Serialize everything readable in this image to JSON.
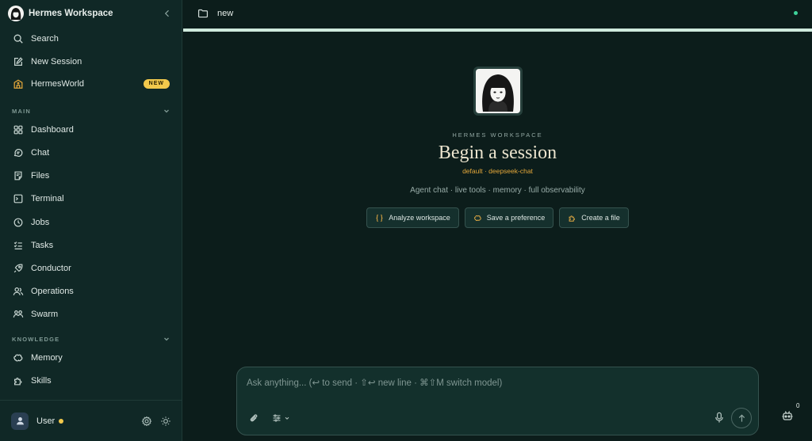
{
  "sidebar": {
    "title": "Hermes Workspace",
    "top_items": [
      {
        "label": "Search",
        "icon": "search-icon"
      },
      {
        "label": "New Session",
        "icon": "compose-icon"
      },
      {
        "label": "HermesWorld",
        "icon": "world-icon",
        "badge": "NEW"
      }
    ],
    "sections": [
      {
        "label": "MAIN",
        "items": [
          {
            "label": "Dashboard",
            "icon": "grid-icon"
          },
          {
            "label": "Chat",
            "icon": "chat-icon"
          },
          {
            "label": "Files",
            "icon": "file-icon"
          },
          {
            "label": "Terminal",
            "icon": "terminal-icon"
          },
          {
            "label": "Jobs",
            "icon": "clock-icon"
          },
          {
            "label": "Tasks",
            "icon": "checklist-icon"
          },
          {
            "label": "Conductor",
            "icon": "rocket-icon"
          },
          {
            "label": "Operations",
            "icon": "users-icon"
          },
          {
            "label": "Swarm",
            "icon": "group-icon"
          }
        ]
      },
      {
        "label": "KNOWLEDGE",
        "items": [
          {
            "label": "Memory",
            "icon": "brain-icon"
          },
          {
            "label": "Skills",
            "icon": "puzzle-icon"
          }
        ]
      }
    ],
    "footer": {
      "user": "User",
      "status_color": "#f2c94c"
    }
  },
  "topbar": {
    "tab_name": "new",
    "connection_color": "#3ed39a"
  },
  "hero": {
    "eyebrow": "HERMES WORKSPACE",
    "headline": "Begin a session",
    "model_line": "default · deepseek-chat",
    "description": "Agent chat · live tools · memory · full observability",
    "actions": [
      {
        "label": "Analyze workspace",
        "icon": "braces-icon"
      },
      {
        "label": "Save a preference",
        "icon": "brain-icon"
      },
      {
        "label": "Create a file",
        "icon": "puzzle-icon"
      }
    ]
  },
  "composer": {
    "placeholder": "Ask anything... (↩ to send · ⇧↩ new line · ⌘⇧M switch model)",
    "value": ""
  },
  "agents": {
    "count": "0"
  },
  "colors": {
    "background": "#0c1d1b",
    "sidebar": "#102826",
    "accent_gold": "#e5a83a",
    "badge": "#f2c94c",
    "online": "#3ed39a"
  }
}
